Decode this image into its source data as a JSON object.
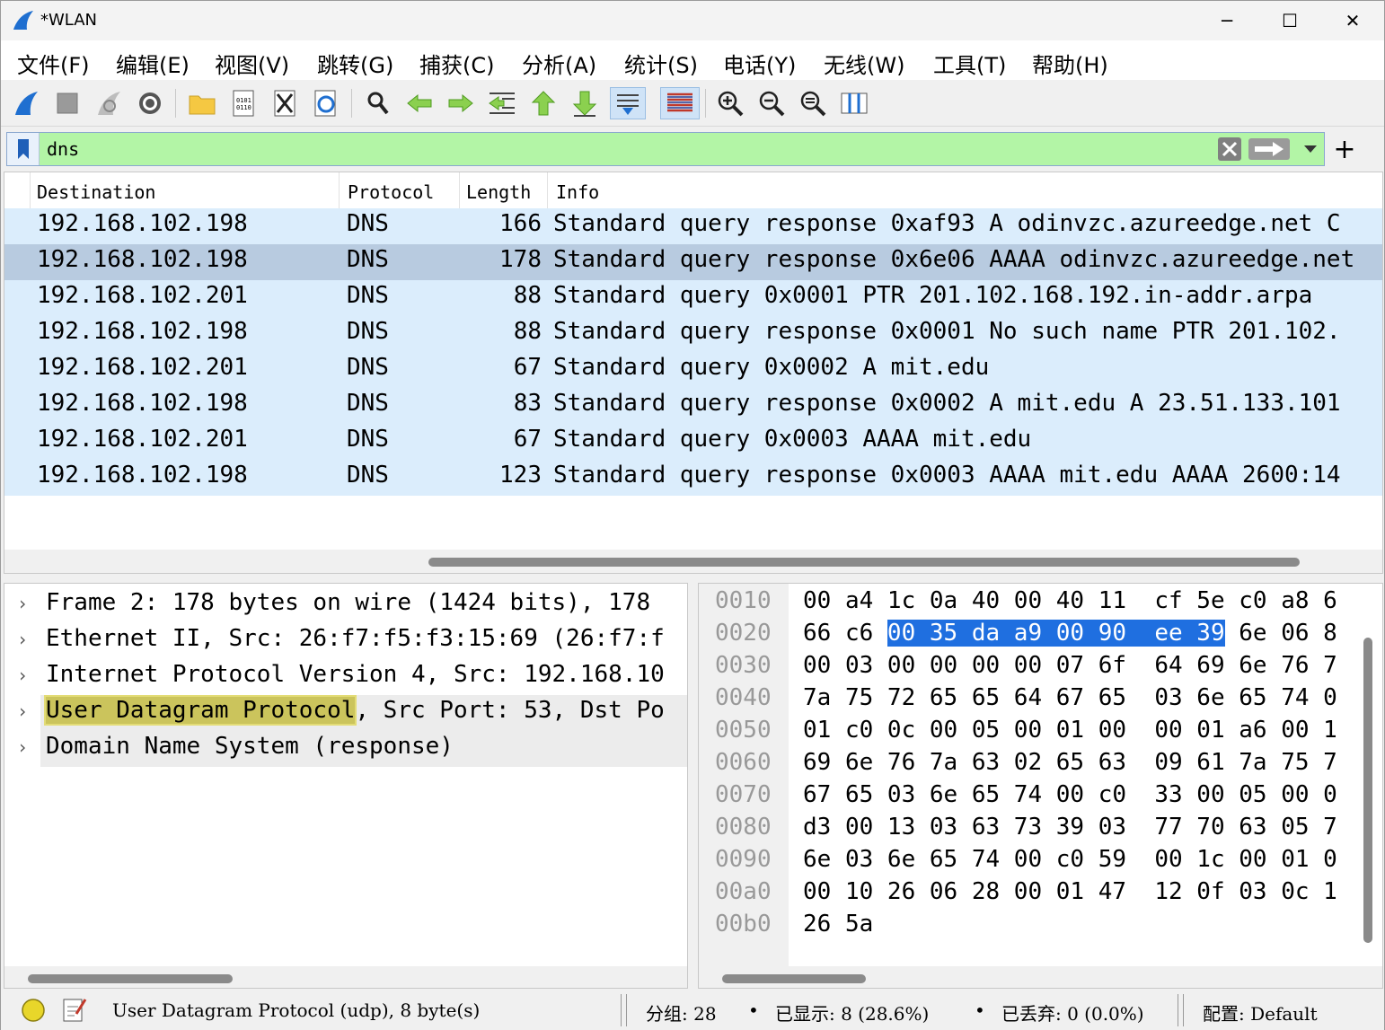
{
  "window": {
    "title": "*WLAN",
    "minimize": "─",
    "maximize": "☐",
    "close": "✕"
  },
  "menu": [
    "文件(F)",
    "编辑(E)",
    "视图(V)",
    "跳转(G)",
    "捕获(C)",
    "分析(A)",
    "统计(S)",
    "电话(Y)",
    "无线(W)",
    "工具(T)",
    "帮助(H)"
  ],
  "filter": {
    "value": "dns"
  },
  "columns": {
    "destination": "Destination",
    "protocol": "Protocol",
    "length": "Length",
    "info": "Info"
  },
  "packets": [
    {
      "destination": "192.168.102.198",
      "protocol": "DNS",
      "length": "166",
      "info": "Standard query response 0xaf93 A odinvzc.azureedge.net C"
    },
    {
      "destination": "192.168.102.198",
      "protocol": "DNS",
      "length": "178",
      "info": "Standard query response 0x6e06 AAAA odinvzc.azureedge.net"
    },
    {
      "destination": "192.168.102.201",
      "protocol": "DNS",
      "length": "88",
      "info": "Standard query 0x0001 PTR 201.102.168.192.in-addr.arpa"
    },
    {
      "destination": "192.168.102.198",
      "protocol": "DNS",
      "length": "88",
      "info": "Standard query response 0x0001 No such name PTR 201.102."
    },
    {
      "destination": "192.168.102.201",
      "protocol": "DNS",
      "length": "67",
      "info": "Standard query 0x0002 A mit.edu"
    },
    {
      "destination": "192.168.102.198",
      "protocol": "DNS",
      "length": "83",
      "info": "Standard query response 0x0002 A mit.edu A 23.51.133.101"
    },
    {
      "destination": "192.168.102.201",
      "protocol": "DNS",
      "length": "67",
      "info": "Standard query 0x0003 AAAA mit.edu"
    },
    {
      "destination": "192.168.102.198",
      "protocol": "DNS",
      "length": "123",
      "info": "Standard query response 0x0003 AAAA mit.edu AAAA 2600:14"
    }
  ],
  "tree": [
    {
      "text": "Frame 2: 178 bytes on wire (1424 bits), 178"
    },
    {
      "text": "Ethernet II, Src: 26:f7:f5:f3:15:69 (26:f7:f"
    },
    {
      "text": "Internet Protocol Version 4, Src: 192.168.10"
    },
    {
      "text_hl": "User Datagram Protocol",
      "text_rest": ", Src Port: 53, Dst Po"
    },
    {
      "text": "Domain Name System (response)"
    }
  ],
  "hex_rows": [
    {
      "off": "0010",
      "hex": "00 a4 1c 0a 40 00 40 11  cf 5e c0 a8 6"
    },
    {
      "off": "0020",
      "pre": "66 c6 ",
      "sel": "00 35 da a9 00 90  ee 39",
      "post": " 6e 06 8"
    },
    {
      "off": "0030",
      "hex": "00 03 00 00 00 00 07 6f  64 69 6e 76 7"
    },
    {
      "off": "0040",
      "hex": "7a 75 72 65 65 64 67 65  03 6e 65 74 0"
    },
    {
      "off": "0050",
      "hex": "01 c0 0c 00 05 00 01 00  00 01 a6 00 1"
    },
    {
      "off": "0060",
      "hex": "69 6e 76 7a 63 02 65 63  09 61 7a 75 7"
    },
    {
      "off": "0070",
      "hex": "67 65 03 6e 65 74 00 c0  33 00 05 00 0"
    },
    {
      "off": "0080",
      "hex": "d3 00 13 03 63 73 39 03  77 70 63 05 7"
    },
    {
      "off": "0090",
      "hex": "6e 03 6e 65 74 00 c0 59  00 1c 00 01 0"
    },
    {
      "off": "00a0",
      "hex": "00 10 26 06 28 00 01 47  12 0f 03 0c 1"
    },
    {
      "off": "00b0",
      "hex": "26 5a"
    }
  ],
  "status": {
    "selected": "User Datagram Protocol (udp), 8 byte(s)",
    "packets": "分组: 28",
    "displayed": "已显示: 8 (28.6%)",
    "dropped": "已丢弃: 0 (0.0%)",
    "profile": "配置: Default"
  },
  "colors": {
    "row_bg": "#dbedfc",
    "row_selected": "#b8cbe0",
    "filter_ok": "#b3f5a6",
    "byte_highlight": "#1f6fe0",
    "field_highlight": "#cbc45c"
  }
}
